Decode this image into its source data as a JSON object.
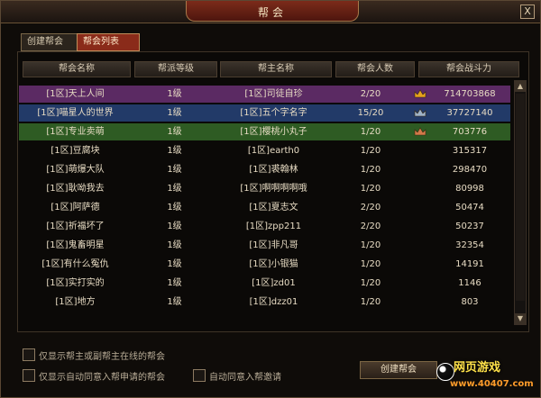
{
  "window": {
    "title": "帮会",
    "close_label": "X"
  },
  "tabs": [
    {
      "label": "创建帮会",
      "active": false
    },
    {
      "label": "帮会列表",
      "active": true
    }
  ],
  "table": {
    "headers": [
      "帮会名称",
      "帮派等级",
      "帮主名称",
      "帮会人数",
      "帮会战斗力"
    ],
    "rows": [
      {
        "name": "[1区]天上人间",
        "level": "1级",
        "leader": "[1区]司徒自珍",
        "members": "2/20",
        "power": "714703868",
        "crown": "gold"
      },
      {
        "name": "[1区]喵星人的世界",
        "level": "1级",
        "leader": "[1区]五个字名字",
        "members": "15/20",
        "power": "37727140",
        "crown": "silver"
      },
      {
        "name": "[1区]专业卖萌",
        "level": "1级",
        "leader": "[1区]樱桃小丸子",
        "members": "1/20",
        "power": "703776",
        "crown": "bronze"
      },
      {
        "name": "[1区]豆腐块",
        "level": "1级",
        "leader": "[1区]earth0",
        "members": "1/20",
        "power": "315317",
        "crown": ""
      },
      {
        "name": "[1区]萌爆大队",
        "level": "1级",
        "leader": "[1区]裘翰林",
        "members": "1/20",
        "power": "298470",
        "crown": ""
      },
      {
        "name": "[1区]耿呦我去",
        "level": "1级",
        "leader": "[1区]啊啊啊啊哦",
        "members": "1/20",
        "power": "80998",
        "crown": ""
      },
      {
        "name": "[1区]阿萨德",
        "level": "1级",
        "leader": "[1区]夏志文",
        "members": "2/20",
        "power": "50474",
        "crown": ""
      },
      {
        "name": "[1区]祈福坏了",
        "level": "1级",
        "leader": "[1区]zpp211",
        "members": "2/20",
        "power": "50237",
        "crown": ""
      },
      {
        "name": "[1区]鬼畜明星",
        "level": "1级",
        "leader": "[1区]非凡哥",
        "members": "1/20",
        "power": "32354",
        "crown": ""
      },
      {
        "name": "[1区]有什么冤仇",
        "level": "1级",
        "leader": "[1区]小银猫",
        "members": "1/20",
        "power": "14191",
        "crown": ""
      },
      {
        "name": "[1区]实打实的",
        "level": "1级",
        "leader": "[1区]zd01",
        "members": "1/20",
        "power": "1146",
        "crown": ""
      },
      {
        "name": "[1区]地方",
        "level": "1级",
        "leader": "[1区]dzz01",
        "members": "1/20",
        "power": "803",
        "crown": ""
      }
    ]
  },
  "filters": {
    "online_only": "仅显示帮主或副帮主在线的帮会",
    "auto_accept_only": "仅显示自动同意入帮申请的帮会",
    "auto_accept_invite": "自动同意入帮邀请"
  },
  "buttons": {
    "create": "创建帮会"
  },
  "watermark": {
    "text": "网页游戏",
    "url": "www.40407.com"
  },
  "colors": {
    "row_purple": "#5b2a63",
    "row_blue": "#223a68",
    "row_green": "#2e5b23",
    "gold": "#e6a21e",
    "silver": "#9fb3c8",
    "bronze": "#d47a4a"
  }
}
